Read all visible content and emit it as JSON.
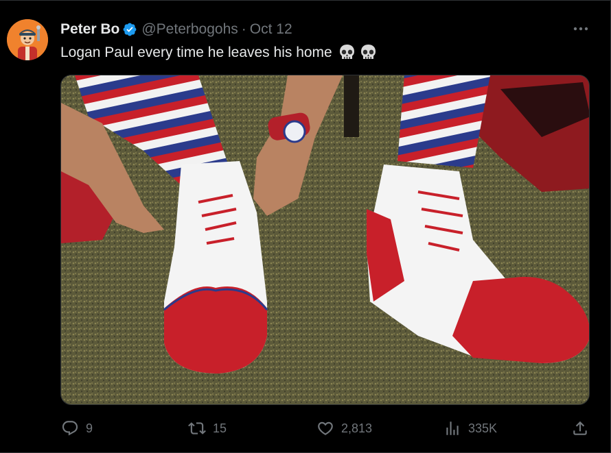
{
  "tweet": {
    "display_name": "Peter Bo",
    "handle": "@Peterbogohs",
    "separator": "·",
    "timestamp": "Oct 12",
    "text": "Logan Paul every time he leaves his home",
    "emojis": [
      "skull-icon",
      "skull-icon"
    ],
    "media_description_icon": "clown-shoes-photo"
  },
  "actions": {
    "replies": "9",
    "retweets": "15",
    "likes": "2,813",
    "views": "335K"
  },
  "colors": {
    "background": "#000000",
    "text": "#e7e9ea",
    "muted": "#71767b",
    "verified": "#1d9bf0",
    "avatar_bg": "#f0822d"
  }
}
